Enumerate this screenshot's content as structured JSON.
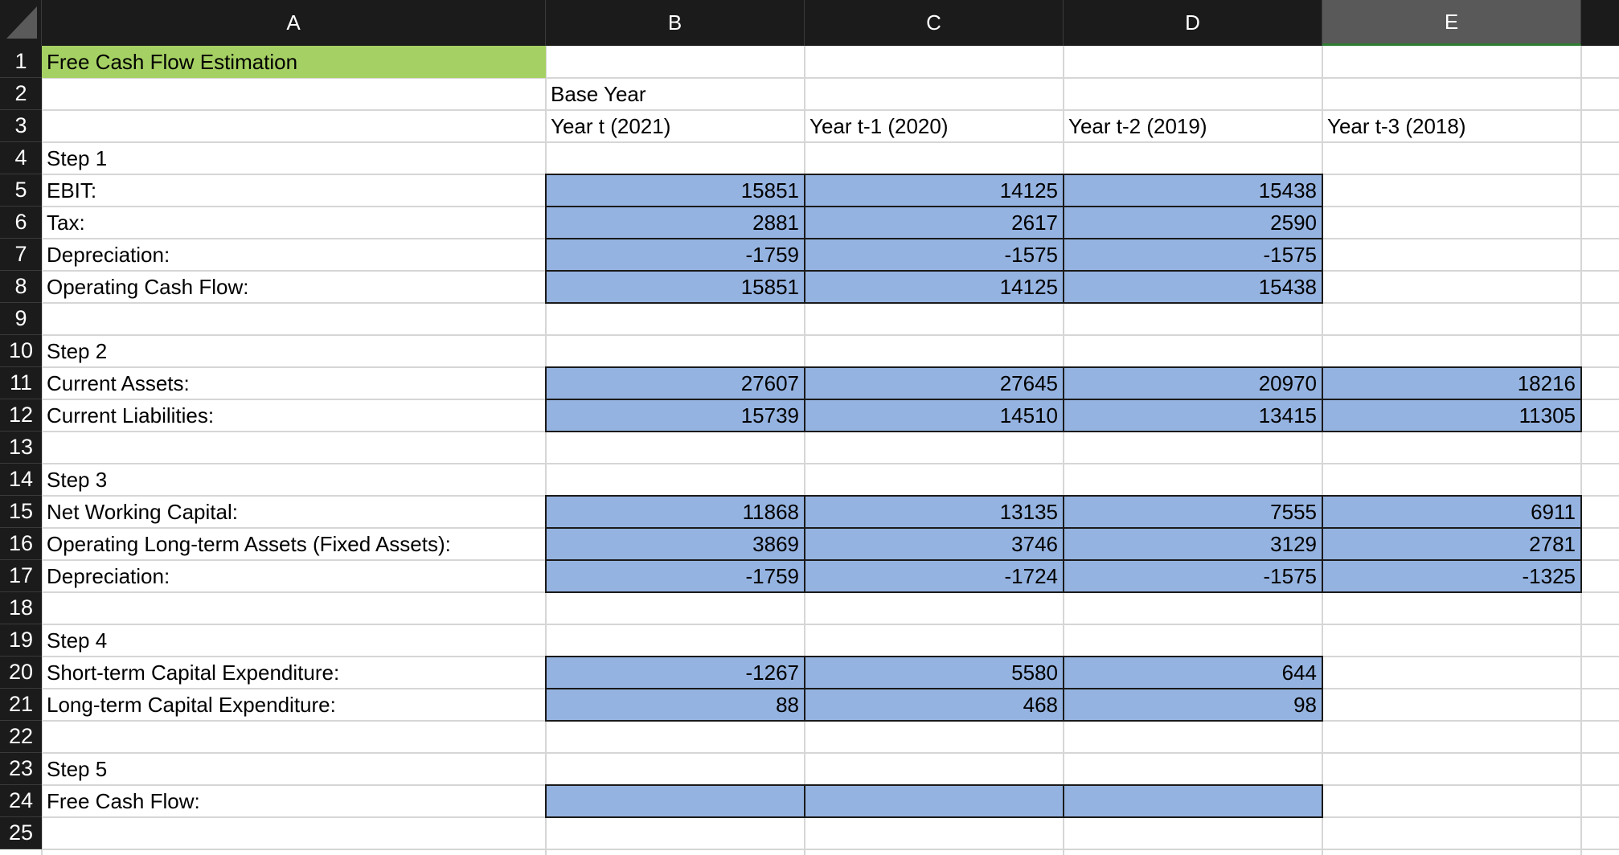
{
  "columns": [
    "A",
    "B",
    "C",
    "D",
    "E"
  ],
  "selected_column": "E",
  "rows": [
    "1",
    "2",
    "3",
    "4",
    "5",
    "6",
    "7",
    "8",
    "9",
    "10",
    "11",
    "12",
    "13",
    "14",
    "15",
    "16",
    "17",
    "18",
    "19",
    "20",
    "21",
    "22",
    "23",
    "24",
    "25"
  ],
  "title": "Free Cash Flow Estimation",
  "headers": {
    "base_year": "Base Year",
    "years": [
      "Year t (2021)",
      "Year t-1 (2020)",
      "Year t-2 (2019)",
      "Year t-3 (2018)"
    ]
  },
  "labels": {
    "r4": "Step 1",
    "r5": "EBIT:",
    "r6": "Tax:",
    "r7": "Depreciation:",
    "r8": "Operating Cash Flow:",
    "r10": "Step 2",
    "r11": "Current Assets:",
    "r12": "Current Liabilities:",
    "r14": "Step 3",
    "r15": "Net Working Capital:",
    "r16": "Operating Long-term Assets (Fixed Assets):",
    "r17": "Depreciation:",
    "r19": "Step 4",
    "r20": "Short-term Capital Expenditure:",
    "r21": "Long-term Capital Expenditure:",
    "r23": "Step 5",
    "r24": "Free Cash Flow:"
  },
  "values": {
    "r5": [
      "15851",
      "14125",
      "15438"
    ],
    "r6": [
      "2881",
      "2617",
      "2590"
    ],
    "r7": [
      "-1759",
      "-1575",
      "-1575"
    ],
    "r8": [
      "15851",
      "14125",
      "15438"
    ],
    "r11": [
      "27607",
      "27645",
      "20970",
      "18216"
    ],
    "r12": [
      "15739",
      "14510",
      "13415",
      "11305"
    ],
    "r15": [
      "11868",
      "13135",
      "7555",
      "6911"
    ],
    "r16": [
      "3869",
      "3746",
      "3129",
      "2781"
    ],
    "r17": [
      "-1759",
      "-1724",
      "-1575",
      "-1325"
    ],
    "r20": [
      "-1267",
      "5580",
      "644"
    ],
    "r21": [
      "88",
      "468",
      "98"
    ],
    "r24": [
      "",
      "",
      ""
    ]
  },
  "colors": {
    "title_fill": "#a5d063",
    "input_fill": "#95b3e0",
    "header_bg": "#1b1b1b",
    "selected_header_bg": "#595959"
  }
}
